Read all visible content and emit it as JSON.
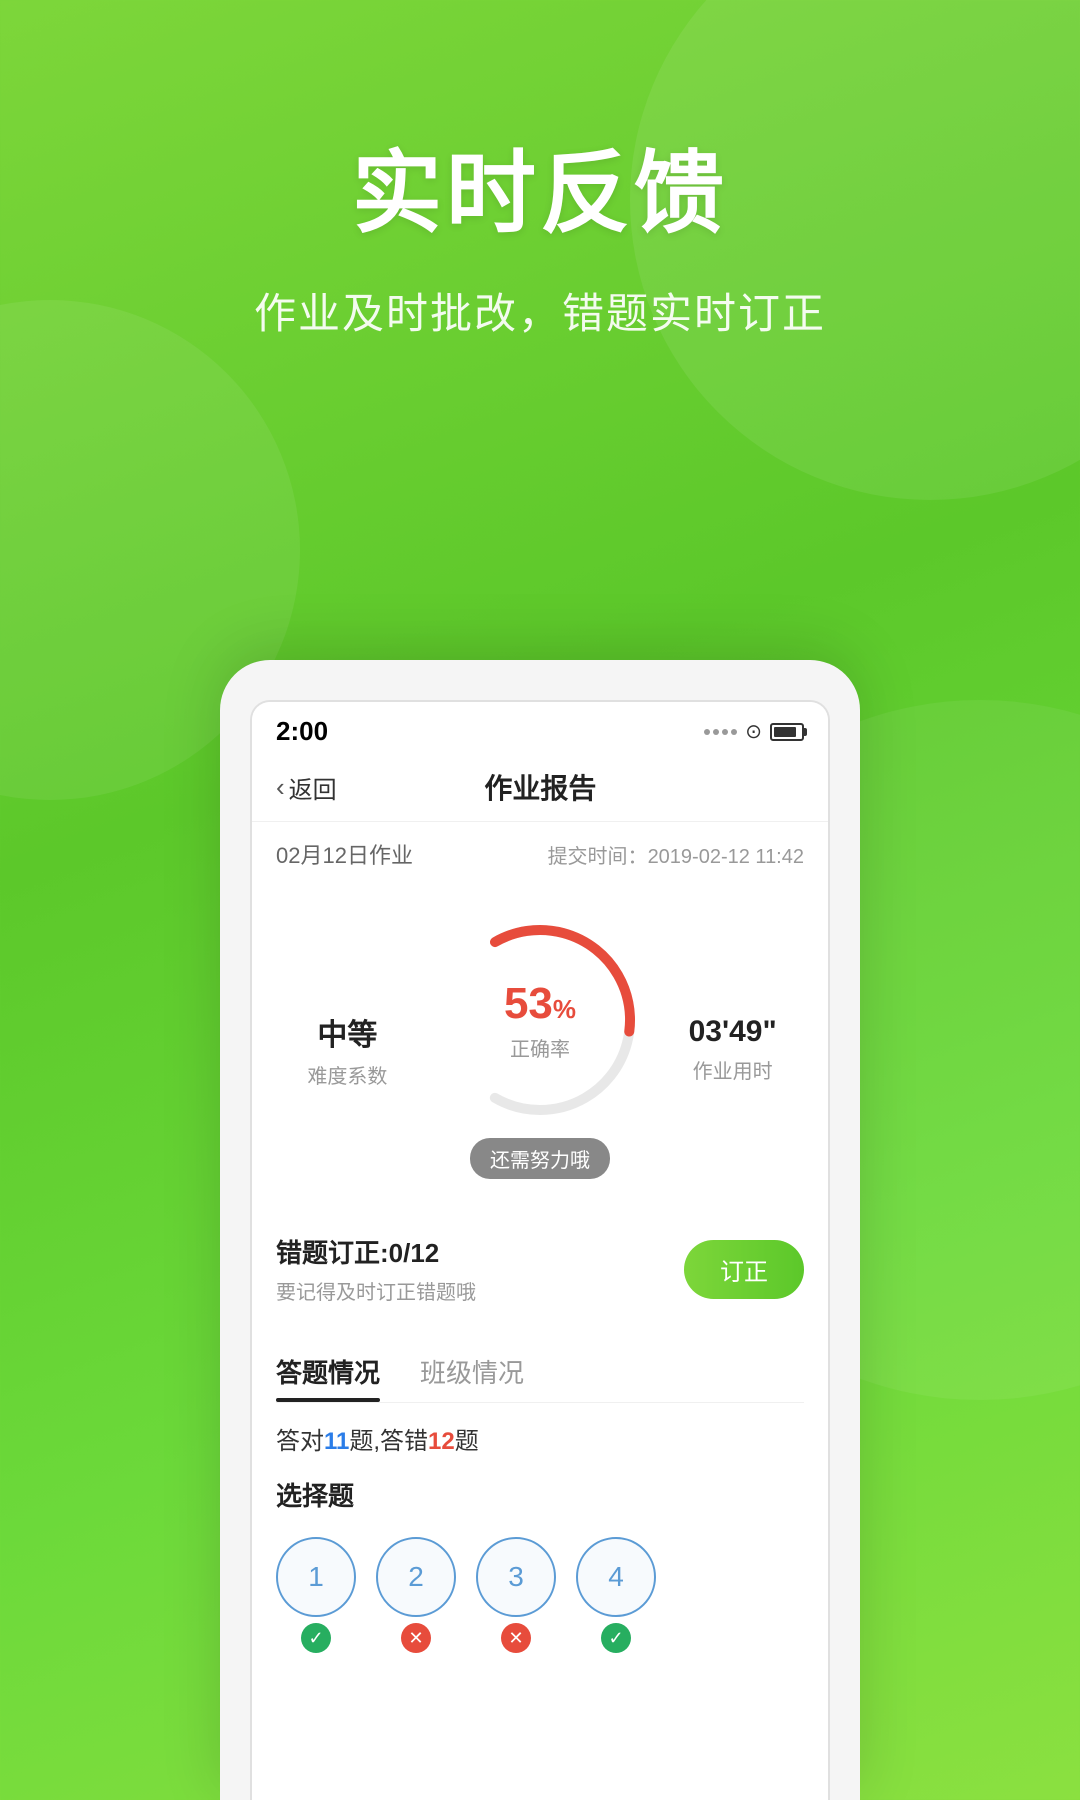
{
  "background": {
    "gradient_start": "#7dd63a",
    "gradient_end": "#5cc82a"
  },
  "header": {
    "main_title": "实时反馈",
    "sub_title": "作业及时批改，错题实时订正"
  },
  "phone": {
    "status_bar": {
      "time": "2:00",
      "signal": "...",
      "wifi": "WiFi",
      "battery": "Battery"
    },
    "nav": {
      "back_label": "返回",
      "title": "作业报告"
    },
    "assignment": {
      "name": "02月12日作业",
      "submit_label": "提交时间：",
      "submit_time": "2019-02-12 11:42"
    },
    "stats": {
      "difficulty_value": "中等",
      "difficulty_label": "难度系数",
      "accuracy_value": "53",
      "accuracy_unit": "%",
      "accuracy_label": "正确率",
      "time_value": "03'49\"",
      "time_label": "作业用时",
      "effort_badge": "还需努力哦"
    },
    "error_correction": {
      "title": "错题订正:0/12",
      "subtitle": "要记得及时订正错题哦",
      "button_label": "订正"
    },
    "tabs": [
      {
        "label": "答题情况",
        "active": true
      },
      {
        "label": "班级情况",
        "active": false
      }
    ],
    "answer_summary": {
      "prefix": "答对",
      "correct_count": "11",
      "middle": "题,答错",
      "wrong_count": "12",
      "suffix": "题"
    },
    "question_type_label": "选择题",
    "questions": [
      {
        "number": "1",
        "status": "correct"
      },
      {
        "number": "2",
        "status": "wrong"
      },
      {
        "number": "3",
        "status": "wrong"
      },
      {
        "number": "4",
        "status": "correct"
      }
    ]
  }
}
